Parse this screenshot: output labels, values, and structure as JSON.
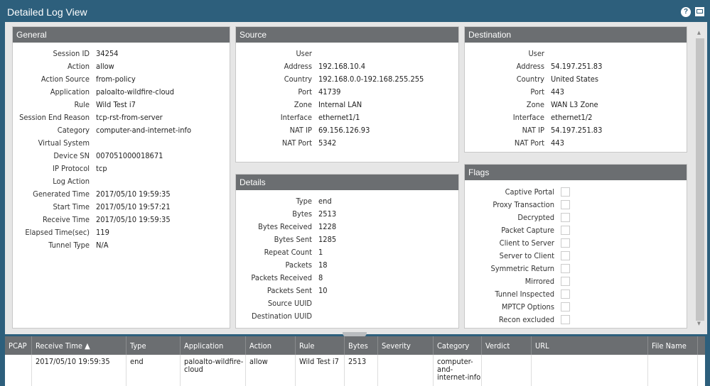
{
  "title": "Detailed Log View",
  "general": {
    "title": "General",
    "rows": [
      {
        "label": "Session ID",
        "value": "34254"
      },
      {
        "label": "Action",
        "value": "allow"
      },
      {
        "label": "Action Source",
        "value": "from-policy"
      },
      {
        "label": "Application",
        "value": "paloalto-wildfire-cloud"
      },
      {
        "label": "Rule",
        "value": "Wild Test i7"
      },
      {
        "label": "Session End Reason",
        "value": "tcp-rst-from-server"
      },
      {
        "label": "Category",
        "value": "computer-and-internet-info"
      },
      {
        "label": "Virtual System",
        "value": ""
      },
      {
        "label": "Device SN",
        "value": "007051000018671"
      },
      {
        "label": "IP Protocol",
        "value": "tcp"
      },
      {
        "label": "Log Action",
        "value": ""
      },
      {
        "label": "Generated Time",
        "value": "2017/05/10 19:59:35"
      },
      {
        "label": "Start Time",
        "value": "2017/05/10 19:57:21"
      },
      {
        "label": "Receive Time",
        "value": "2017/05/10 19:59:35"
      },
      {
        "label": "Elapsed Time(sec)",
        "value": "119"
      },
      {
        "label": "Tunnel Type",
        "value": "N/A"
      }
    ]
  },
  "source": {
    "title": "Source",
    "rows": [
      {
        "label": "User",
        "value": ""
      },
      {
        "label": "Address",
        "value": "192.168.10.4"
      },
      {
        "label": "Country",
        "value": "192.168.0.0-192.168.255.255"
      },
      {
        "label": "Port",
        "value": "41739"
      },
      {
        "label": "Zone",
        "value": "Internal LAN"
      },
      {
        "label": "Interface",
        "value": "ethernet1/1"
      },
      {
        "label": "NAT IP",
        "value": "69.156.126.93"
      },
      {
        "label": "NAT Port",
        "value": "5342"
      }
    ]
  },
  "destination": {
    "title": "Destination",
    "rows": [
      {
        "label": "User",
        "value": ""
      },
      {
        "label": "Address",
        "value": "54.197.251.83"
      },
      {
        "label": "Country",
        "value": "United States"
      },
      {
        "label": "Port",
        "value": "443"
      },
      {
        "label": "Zone",
        "value": "WAN L3 Zone"
      },
      {
        "label": "Interface",
        "value": "ethernet1/2"
      },
      {
        "label": "NAT IP",
        "value": "54.197.251.83"
      },
      {
        "label": "NAT Port",
        "value": "443"
      }
    ]
  },
  "details": {
    "title": "Details",
    "rows": [
      {
        "label": "Type",
        "value": "end"
      },
      {
        "label": "Bytes",
        "value": "2513"
      },
      {
        "label": "Bytes Received",
        "value": "1228"
      },
      {
        "label": "Bytes Sent",
        "value": "1285"
      },
      {
        "label": "Repeat Count",
        "value": "1"
      },
      {
        "label": "Packets",
        "value": "18"
      },
      {
        "label": "Packets Received",
        "value": "8"
      },
      {
        "label": "Packets Sent",
        "value": "10"
      },
      {
        "label": "Source UUID",
        "value": ""
      },
      {
        "label": "Destination UUID",
        "value": ""
      }
    ]
  },
  "flags": {
    "title": "Flags",
    "rows": [
      {
        "label": "Captive Portal",
        "checked": false
      },
      {
        "label": "Proxy Transaction",
        "checked": false
      },
      {
        "label": "Decrypted",
        "checked": false
      },
      {
        "label": "Packet Capture",
        "checked": false
      },
      {
        "label": "Client to Server",
        "checked": false
      },
      {
        "label": "Server to Client",
        "checked": false
      },
      {
        "label": "Symmetric Return",
        "checked": false
      },
      {
        "label": "Mirrored",
        "checked": false
      },
      {
        "label": "Tunnel Inspected",
        "checked": false
      },
      {
        "label": "MPTCP Options",
        "checked": false
      },
      {
        "label": "Recon excluded",
        "checked": false
      }
    ]
  },
  "table": {
    "columns": [
      "PCAP",
      "Receive Time ▲",
      "Type",
      "Application",
      "Action",
      "Rule",
      "Bytes",
      "Severity",
      "Category",
      "Verdict",
      "URL",
      "File Name"
    ],
    "rows": [
      [
        "",
        "2017/05/10 19:59:35",
        "end",
        "paloalto-wildfire-cloud",
        "allow",
        "Wild Test i7",
        "2513",
        "",
        "computer-and-internet-info",
        "",
        "",
        ""
      ]
    ]
  }
}
